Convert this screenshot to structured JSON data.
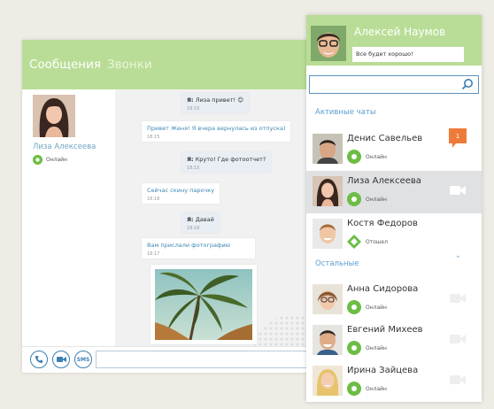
{
  "chat": {
    "tabs": {
      "messages": "Сообщения",
      "calls": "Звонки"
    },
    "contact": {
      "name": "Лиза Алексеева",
      "status": "Онлайн"
    },
    "messages": [
      {
        "direction": "out",
        "sender": "Я:",
        "text": "Лиза привет! 😊",
        "time": "18:15"
      },
      {
        "direction": "in",
        "text": "Привет Женя! Я вчера вернулась из отпуска)",
        "time": "18:15"
      },
      {
        "direction": "out",
        "sender": "Я:",
        "text": "Круто! Где фотоотчет?",
        "time": "18:15"
      },
      {
        "direction": "in",
        "text": "Сейчас скину парочку",
        "time": "18:16"
      },
      {
        "direction": "out",
        "sender": "Я:",
        "text": "Давай",
        "time": "18:16"
      },
      {
        "direction": "in",
        "text": "Вам прислали фотографию",
        "time": "18:17"
      }
    ],
    "input_buttons": {
      "sms": "SMS"
    }
  },
  "panel": {
    "me": {
      "name": "Алексей Наумов",
      "mood": "Все будет хорошо!"
    },
    "sections": {
      "active": "Активные чаты",
      "others": "Остальные"
    },
    "active_contacts": [
      {
        "name": "Денис Савельев",
        "status": "Онлайн",
        "badge": "1"
      },
      {
        "name": "Лиза Алексеева",
        "status": "Онлайн"
      },
      {
        "name": "Костя Федоров",
        "status": "Отошел"
      }
    ],
    "other_contacts": [
      {
        "name": "Анна Сидорова",
        "status": "Онлайн"
      },
      {
        "name": "Евгений Михеев",
        "status": "Онлайн"
      },
      {
        "name": "Ирина Зайцева",
        "status": "Онлайн"
      }
    ]
  },
  "colors": {
    "header_green": "#b9dd96",
    "link_blue": "#5a9ed0",
    "status_green": "#6dbd45",
    "badge_orange": "#ee7b3a",
    "selected_row": "#dfe1e3"
  }
}
